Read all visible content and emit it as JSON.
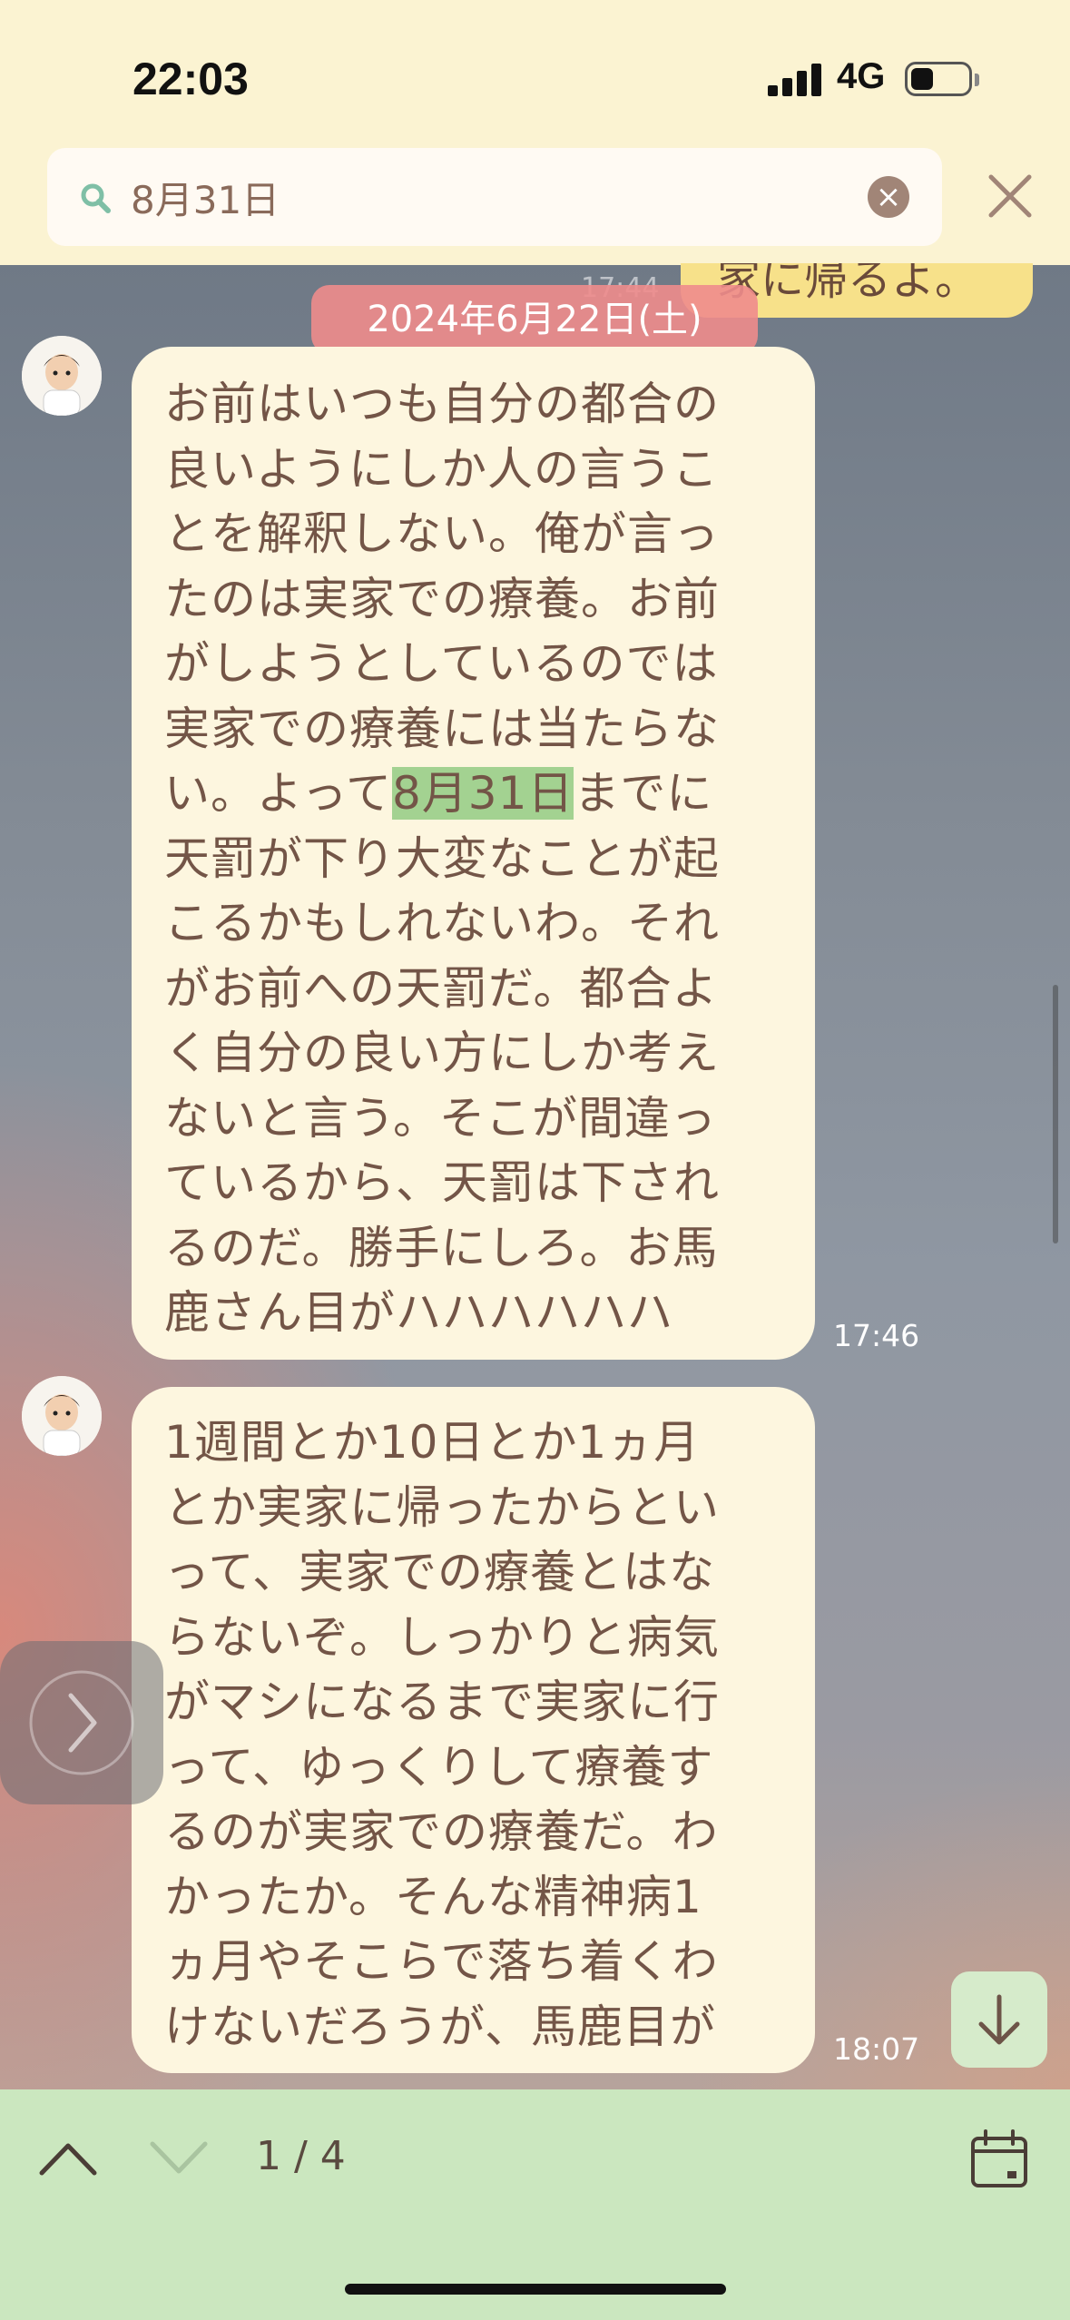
{
  "status_bar": {
    "time": "22:03",
    "network": "4G"
  },
  "search": {
    "query": "8月31日"
  },
  "previous_message": {
    "text": "家に帰るよ。",
    "time": "17:44"
  },
  "date_separator": "2024年6月22日(土)",
  "messages": [
    {
      "lines": [
        "お前はいつも自分の都合の",
        "良いようにしか人の言うこ",
        "とを解釈しない。俺が言っ",
        "たのは実家での療養。お前",
        "がしようとしているのでは",
        "実家での療養には当たらな"
      ],
      "line7_before": "い。よって",
      "line7_highlight": "8月31日",
      "line7_after": "までに",
      "lines_rest": [
        "天罰が下り大変なことが起",
        "こるかもしれないわ。それ",
        "がお前への天罰だ。都合よ",
        "く自分の良い方にしか考え",
        "ないと言う。そこが間違っ",
        "ているから、天罰は下され",
        "るのだ。勝手にしろ。お馬",
        "鹿さん目がハハハハハハ"
      ],
      "time": "17:46"
    },
    {
      "lines": [
        "1週間とか10日とか1ヵ月",
        "とか実家に帰ったからとい",
        "って、実家での療養とはな",
        "らないぞ。しっかりと病気",
        "がマシになるまで実家に行",
        "って、ゆっくりして療養す",
        "るのが実家での療養だ。わ",
        "かったか。そんな精神病1",
        "ヵ月やそこらで落ち着くわ",
        "けないだろうが、馬鹿目が"
      ],
      "time": "18:07"
    }
  ],
  "result_nav": {
    "counter": "1 / 4"
  },
  "colors": {
    "header_bg": "#fbf3d2",
    "bubble_bg": "#fdf6df",
    "bubble_text": "#735547",
    "highlight": "#a3d291",
    "date_pill": "#ee8c8c",
    "bottom_bar": "#cbe7bf"
  }
}
